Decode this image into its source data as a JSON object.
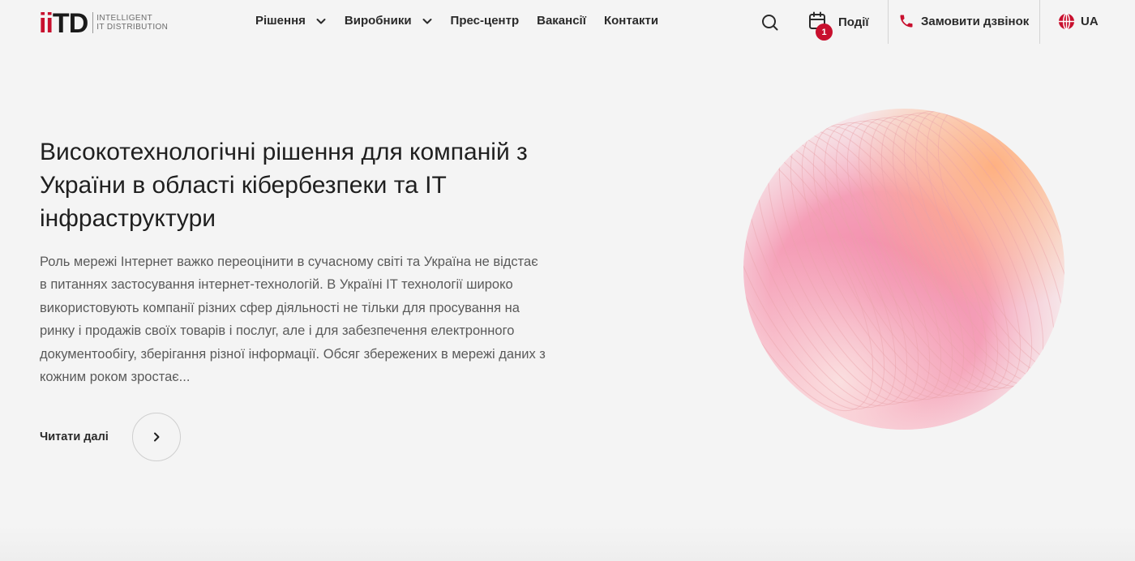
{
  "header": {
    "logo": {
      "mark": [
        "i",
        "i",
        "T",
        "D"
      ],
      "line1": "INTELLIGENT",
      "line2": "IT DISTRIBUTION"
    },
    "nav": [
      {
        "label": "Рішення",
        "has_dropdown": true
      },
      {
        "label": "Виробники",
        "has_dropdown": true
      },
      {
        "label": "Прес-центр",
        "has_dropdown": false
      },
      {
        "label": "Вакансії",
        "has_dropdown": false
      },
      {
        "label": "Контакти",
        "has_dropdown": false
      }
    ],
    "search_icon": "search-icon",
    "events": {
      "label": "Події",
      "badge_count": "1",
      "icon": "calendar-icon"
    },
    "callback": {
      "label": "Замовити дзвінок",
      "icon": "phone-icon"
    },
    "language": {
      "label": "UA",
      "icon": "globe-icon"
    }
  },
  "hero": {
    "title": "Високотехнологічні рішення для компаній з України в області кібербезпеки та IT інфраструктури",
    "text": "Роль мережі Інтернет важко переоцінити в сучасному світі та Україна не відстає в питаннях застосування інтернет-технологій. В Україні IT технології широко використовують компанії різних сфер діяльності не тільки для просування на ринку і продажів своїх товарів і послуг, але і для забезпечення електронного документообігу, зберігання різної інформації. Обсяг збережених в мережі даних з кожним роком зростає...",
    "read_more": "Читати далі"
  },
  "colors": {
    "brand_red": "#c8102e",
    "background": "#f4f4f4",
    "sphere_pink": "#f48fb1",
    "sphere_orange": "#ffab76"
  }
}
